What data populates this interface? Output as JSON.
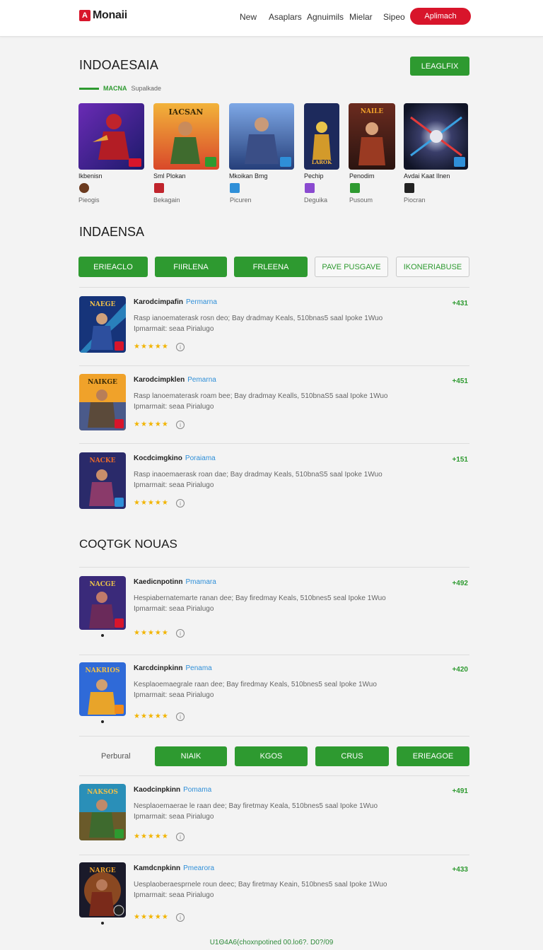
{
  "header": {
    "logo_mark": "A",
    "logo_text": "Monaii",
    "nav": [
      "New",
      "Asaplars",
      "Agnuimils",
      "Mielar",
      "Sipeo"
    ],
    "cta": "Aplimach"
  },
  "section1": {
    "title": "INDOAESAIA",
    "button": "LEAGLFIX",
    "sub_green": "MACNA",
    "sub_gray": "Supalkade",
    "tiles": [
      {
        "name": "Ikbenisn",
        "sub": "Pieogis"
      },
      {
        "name": "Sml Plokan",
        "sub": "Bekagain"
      },
      {
        "name": "Mkoikan Bmg",
        "sub": "Picuren"
      },
      {
        "name": "Pechip",
        "sub": "Deguika"
      },
      {
        "name": "Penodim",
        "sub": "Pusoum"
      },
      {
        "name": "Avdai Kaat Ilnen",
        "sub": "Piocran"
      }
    ]
  },
  "section2": {
    "title": "INDAENSA",
    "filters": [
      "ERIEACLO",
      "FIIRLENA",
      "FRLEENA",
      "PAVE PUSGAVE",
      "IKONERIABUSE"
    ],
    "items": [
      {
        "title": "Karodcimpafin",
        "tag": "Permarna",
        "price": "+431",
        "line1": "Rasp ianoematerask rosn deo; Bay dradmay Keals, 510bnas5 saal Ipoke 1Wuo",
        "line2": "Ipmarmait: seaa Pirialugo",
        "stars": "★★★★★",
        "info": "i"
      },
      {
        "title": "Karodcimpklen",
        "tag": "Pemarna",
        "price": "+451",
        "line1": "Rasp lanoematerask roam bee; Bay dradmay Kealls, 510bnaS5 saal Ipoke 1Wuo",
        "line2": "Ipmarmait: seaa Pirialugo",
        "stars": "★★★★★",
        "info": "i"
      },
      {
        "title": "Kocdcimgkino",
        "tag": "Poraiama",
        "price": "+151",
        "line1": "Rasp inaoemaerask roan dae; Bay dradmay Keals, 510bnaS5 saal Ipoke 1Wuo",
        "line2": "Ipmarmait: seaa Pirialugo",
        "stars": "★★★★★",
        "info": "i"
      }
    ]
  },
  "section3": {
    "title": "COQTGK NOUAS",
    "items": [
      {
        "title": "Kaedicnpotinn",
        "tag": "Pmamara",
        "price": "+492",
        "line1": "Hespiabernatemarte ranan dee; Bay firedmay Keals, 510bnes5 seal Ipoke 1Wuo",
        "line2": "Ipmarmait: seaa Pirialugo",
        "stars": "★★★★★",
        "info": "i"
      },
      {
        "title": "Karcdcinpkinn",
        "tag": "Penama",
        "price": "+420",
        "line1": "Kesplaoemaegrale raan dee; Bay firedmay Keals, 510bnes5 seal Ipoke 1Wuo",
        "line2": "Ipmarmait: seaa Pirialugo",
        "stars": "★★★★★",
        "info": "i"
      }
    ],
    "pills_label": "Perbural",
    "pills": [
      "NIAIK",
      "KGOS",
      "CRUS",
      "ERIEAGOE"
    ],
    "items2": [
      {
        "title": "Kaodcinpkinn",
        "tag": "Pomama",
        "price": "+491",
        "line1": "Nesplaoemaerae le raan dee; Bay firetmay Keala, 510bnes5 saal Ipoke 1Wuo",
        "line2": "Ipmarmait: seaa Pirialugo",
        "stars": "★★★★★",
        "info": "i"
      },
      {
        "title": "Kamdcnpkinn",
        "tag": "Pmearora",
        "price": "+433",
        "line1": "Uesplaoberaesprnele roun deec; Bay firetmay Keain, 510bnes5 saal Ipoke 1Wuo",
        "line2": "Ipmarmait: seaa Pirialugo",
        "stars": "★★★★★",
        "info": "i"
      }
    ]
  },
  "footer": "U1Θ4A6(choxnpotined 00.lo6?. D0?/09",
  "colors": {
    "brand_red": "#d8152b",
    "accent_green": "#2e9a30",
    "tag_blue": "#2f8fd8",
    "star": "#f2b400"
  }
}
